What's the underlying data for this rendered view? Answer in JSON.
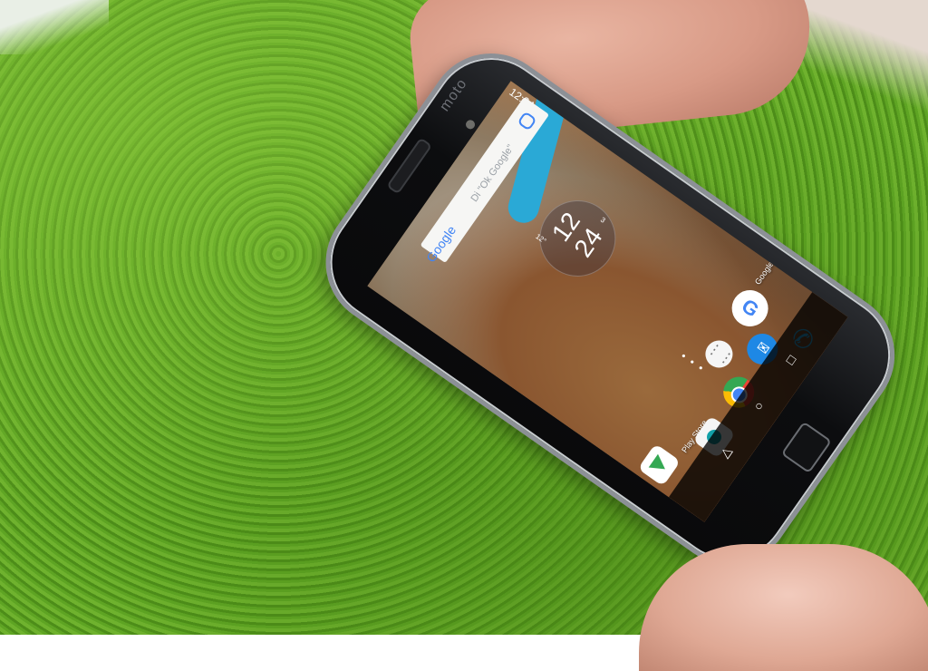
{
  "status_bar": {
    "time": "12:24"
  },
  "search_widget": {
    "brand": "Google",
    "hint": "Di \"Ok Google\""
  },
  "clock_widget": {
    "hour": "12",
    "minute": "24",
    "weather_badge": "3",
    "temperature": "12°"
  },
  "phone_brand": "moto",
  "apps": [
    {
      "name": "play-store",
      "label": "Play Store"
    },
    {
      "name": "google",
      "label": "Google"
    }
  ],
  "nav": {
    "back": "◁",
    "home": "○",
    "recent": "□"
  }
}
